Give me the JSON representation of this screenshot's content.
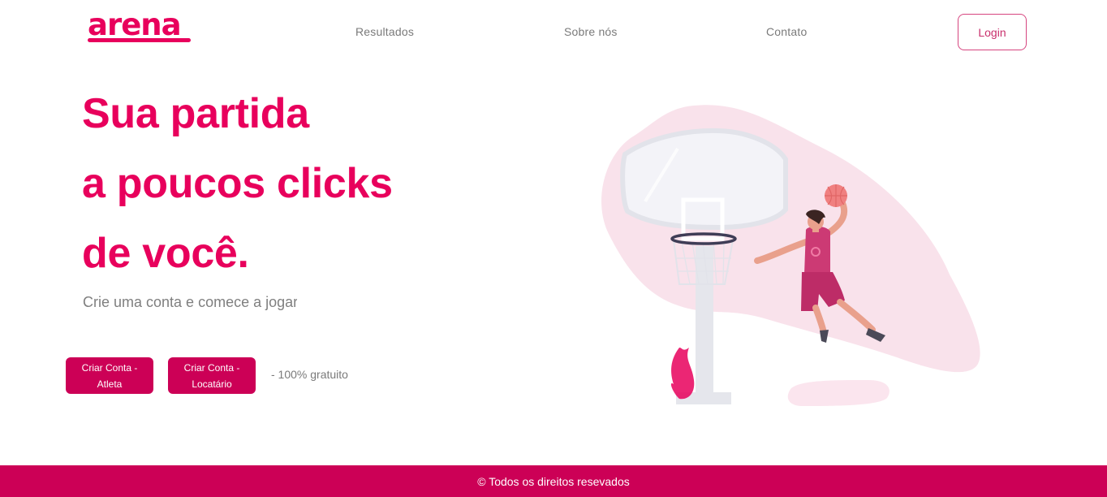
{
  "brand": {
    "logo_text": "arena",
    "accent_color": "#e8005c",
    "footer_color": "#cc0056"
  },
  "nav": {
    "items": [
      {
        "label": "Resultados"
      },
      {
        "label": "Sobre nós"
      },
      {
        "label": "Contato"
      }
    ],
    "login_label": "Login"
  },
  "hero": {
    "title_lines": [
      "Sua partida",
      "a poucos clicks",
      "de você."
    ],
    "subtitle": "Crie uma conta e comece a jogar",
    "buttons": [
      {
        "label": "Criar Conta - Atleta"
      },
      {
        "label": "Criar Conta - Locatário"
      }
    ],
    "free_note": "- 100% gratuito"
  },
  "illustration": {
    "icon": "basketball-player-dunk-illustration"
  },
  "footer": {
    "text": "© Todos os direitos resevados"
  }
}
